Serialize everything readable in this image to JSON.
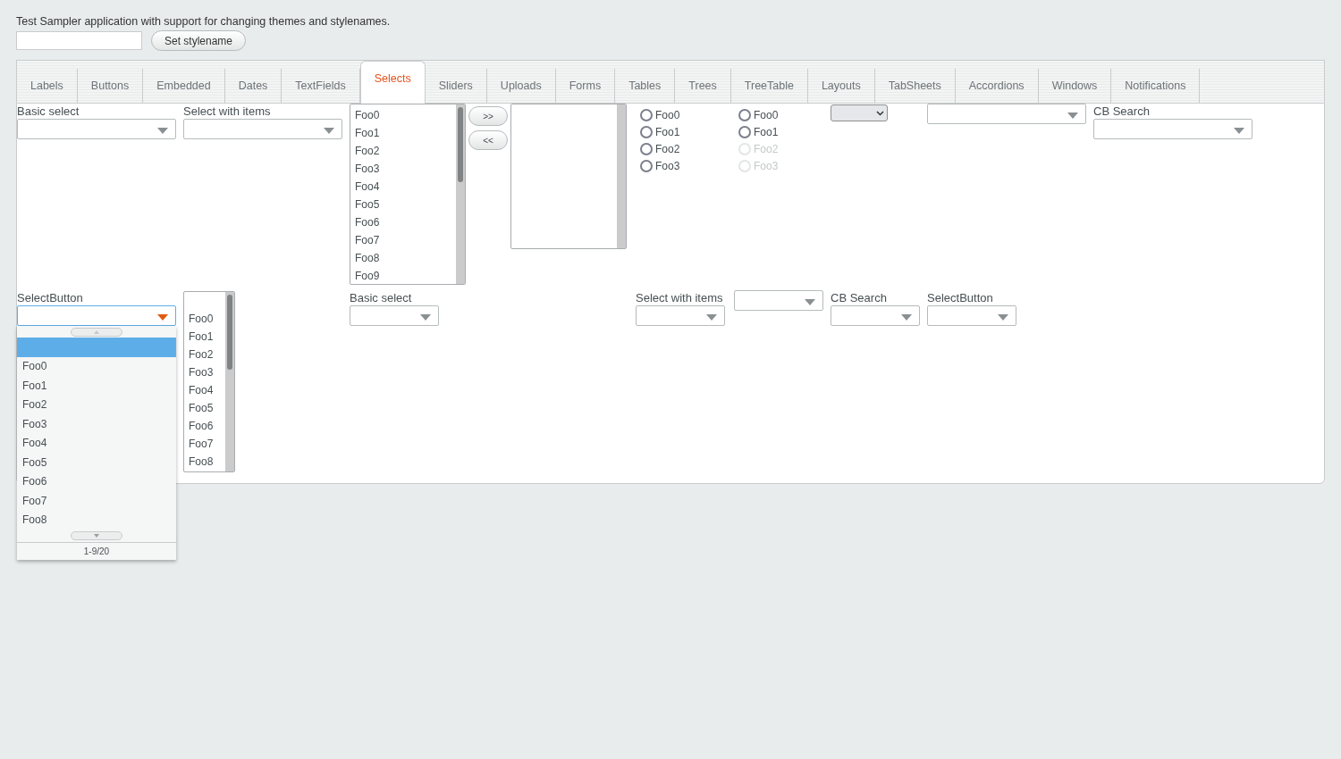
{
  "header": {
    "description": "Test Sampler application with support for changing themes and stylenames.",
    "set_button": "Set stylename"
  },
  "tabs": [
    {
      "label": "Labels",
      "selected": false
    },
    {
      "label": "Buttons",
      "selected": false
    },
    {
      "label": "Embedded",
      "selected": false
    },
    {
      "label": "Dates",
      "selected": false
    },
    {
      "label": "TextFields",
      "selected": false
    },
    {
      "label": "Selects",
      "selected": true
    },
    {
      "label": "Sliders",
      "selected": false
    },
    {
      "label": "Uploads",
      "selected": false
    },
    {
      "label": "Forms",
      "selected": false
    },
    {
      "label": "Tables",
      "selected": false
    },
    {
      "label": "Trees",
      "selected": false
    },
    {
      "label": "TreeTable",
      "selected": false
    },
    {
      "label": "Layouts",
      "selected": false
    },
    {
      "label": "TabSheets",
      "selected": false
    },
    {
      "label": "Accordions",
      "selected": false
    },
    {
      "label": "Windows",
      "selected": false
    },
    {
      "label": "Notifications",
      "selected": false
    }
  ],
  "rows": [
    [
      {
        "kind": "select",
        "label": "Basic select",
        "open": false
      },
      {
        "kind": "select",
        "label": "Select with items",
        "open": false
      },
      {
        "kind": "twin_select",
        "left_items": [
          "Foo0",
          "Foo1",
          "Foo2",
          "Foo3",
          "Foo4",
          "Foo5",
          "Foo6",
          "Foo7",
          "Foo8",
          "Foo9"
        ],
        "add_button": ">>",
        "remove_button": "<<"
      },
      {
        "kind": "option_group",
        "options": [
          {
            "label": "Foo0",
            "checked": false,
            "disabled": false
          },
          {
            "label": "Foo1",
            "checked": false,
            "disabled": false
          },
          {
            "label": "Foo2",
            "checked": false,
            "disabled": false
          },
          {
            "label": "Foo3",
            "checked": false,
            "disabled": false
          }
        ]
      },
      {
        "kind": "option_group",
        "options": [
          {
            "label": "Foo0",
            "checked": false,
            "disabled": false
          },
          {
            "label": "Foo1",
            "checked": false,
            "disabled": false
          },
          {
            "label": "Foo2",
            "checked": false,
            "disabled": true
          },
          {
            "label": "Foo3",
            "checked": false,
            "disabled": true
          }
        ]
      },
      {
        "kind": "native_select"
      },
      {
        "kind": "select",
        "open": false
      },
      {
        "kind": "select",
        "label": "CB Search",
        "open": false
      }
    ],
    [
      {
        "kind": "select",
        "label": "SelectButton",
        "open": true,
        "popup": {
          "blank_selected": true,
          "items": [
            "Foo0",
            "Foo1",
            "Foo2",
            "Foo3",
            "Foo4",
            "Foo5",
            "Foo6",
            "Foo7",
            "Foo8"
          ],
          "pager": "1-9/20"
        }
      },
      {
        "kind": "listbox",
        "items": [
          "Foo0",
          "Foo1",
          "Foo2",
          "Foo3",
          "Foo4",
          "Foo5",
          "Foo6",
          "Foo7",
          "Foo8"
        ]
      },
      {
        "kind": "select",
        "label": "Basic select",
        "open": false
      },
      {
        "kind": "select",
        "label": "Select with items",
        "open": false
      },
      {
        "kind": "select",
        "open": false
      },
      {
        "kind": "select",
        "label": "CB Search",
        "open": false
      },
      {
        "kind": "select",
        "label": "SelectButton",
        "open": false
      }
    ]
  ]
}
